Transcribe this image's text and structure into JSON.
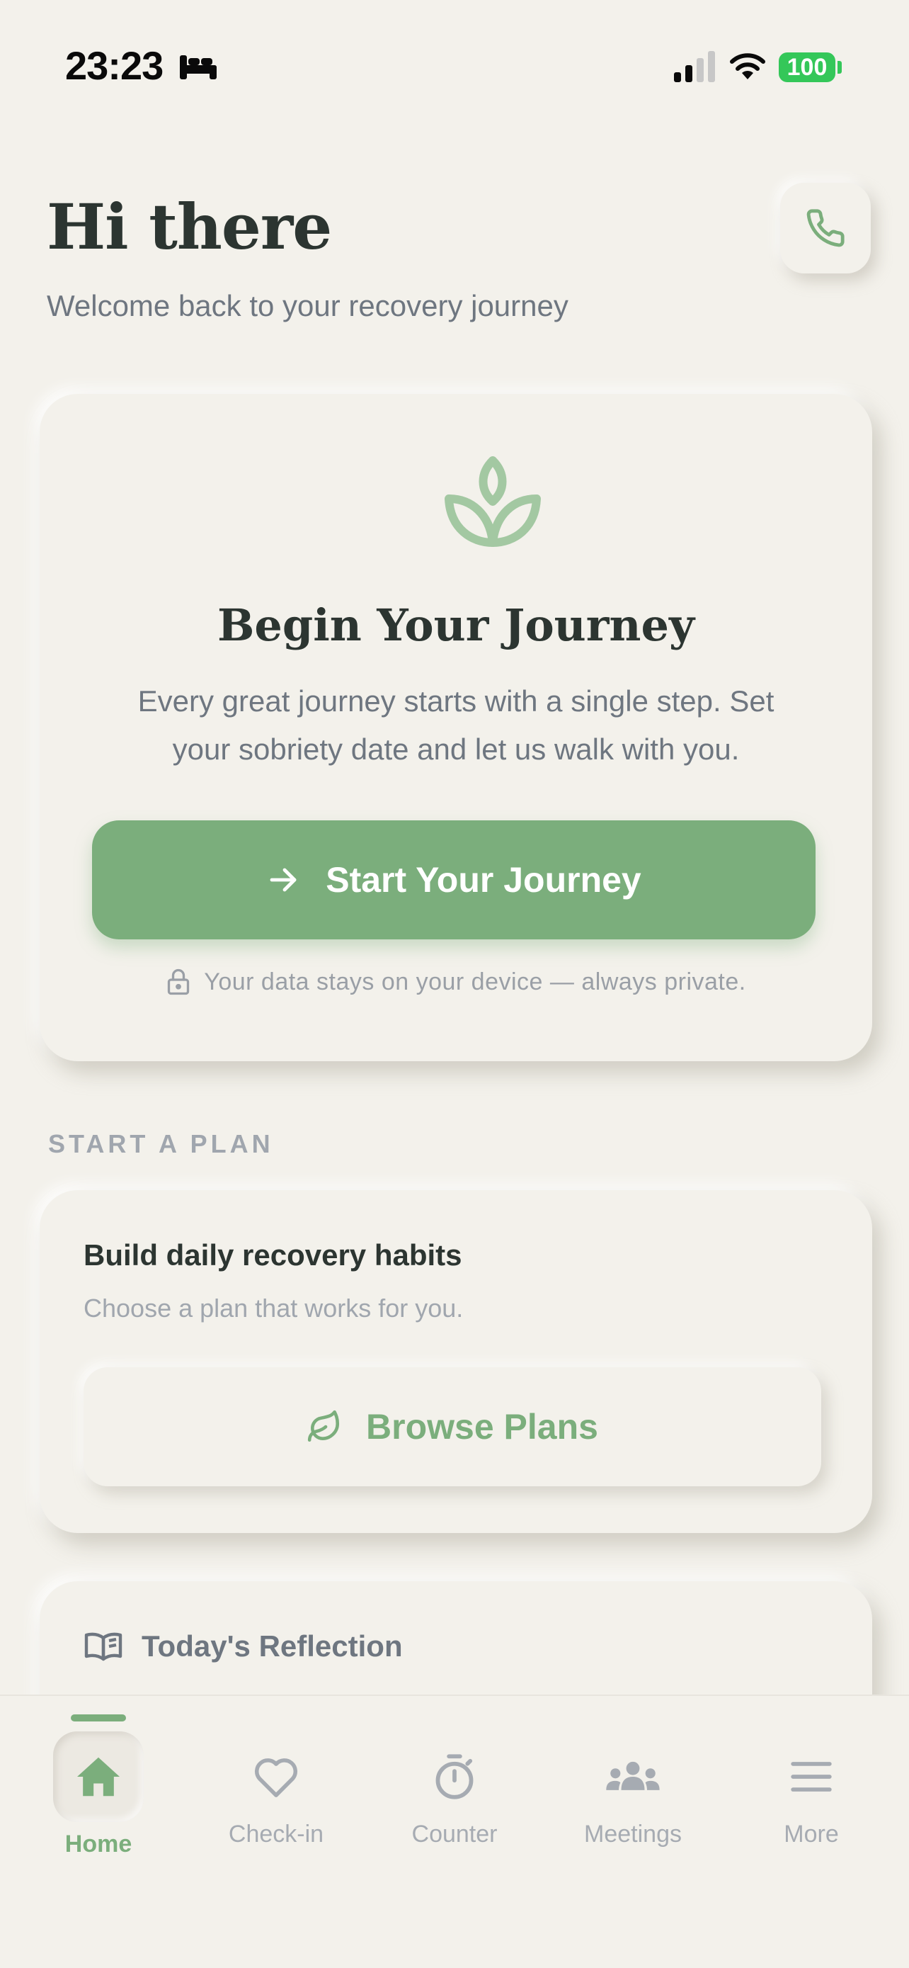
{
  "status_bar": {
    "time": "23:23",
    "battery": "100",
    "icons": [
      "bed-icon",
      "cellular-signal-icon",
      "wifi-icon",
      "battery-icon"
    ]
  },
  "header": {
    "greeting": "Hi there",
    "subtitle": "Welcome back to your recovery journey",
    "call_icon": "phone-icon"
  },
  "journey_card": {
    "icon": "sprout-icon",
    "title": "Begin Your Journey",
    "description": "Every great journey starts with a single step. Set your sobriety date and let us walk with you.",
    "button_label": "Start Your Journey",
    "button_icon": "arrow-right-icon",
    "privacy_note": "Your data stays on your device — always private.",
    "privacy_icon": "lock-icon"
  },
  "plan_section": {
    "label": "START A PLAN",
    "title": "Build daily recovery habits",
    "subtitle": "Choose a plan that works for you.",
    "button_label": "Browse Plans",
    "button_icon": "leaf-icon"
  },
  "reflection": {
    "title": "Today's Reflection",
    "icon": "open-book-icon"
  },
  "tab_bar": {
    "items": [
      {
        "label": "Home",
        "icon": "home-icon",
        "active": true
      },
      {
        "label": "Check-in",
        "icon": "heart-icon",
        "active": false
      },
      {
        "label": "Counter",
        "icon": "stopwatch-icon",
        "active": false
      },
      {
        "label": "Meetings",
        "icon": "group-icon",
        "active": false
      },
      {
        "label": "More",
        "icon": "menu-icon",
        "active": false
      }
    ]
  },
  "colors": {
    "background": "#F3F1EB",
    "accent": "#7BAE7C",
    "text_primary": "#2C3531",
    "text_secondary": "#6E7680",
    "text_muted": "#A0A6AE",
    "battery": "#34C759"
  }
}
